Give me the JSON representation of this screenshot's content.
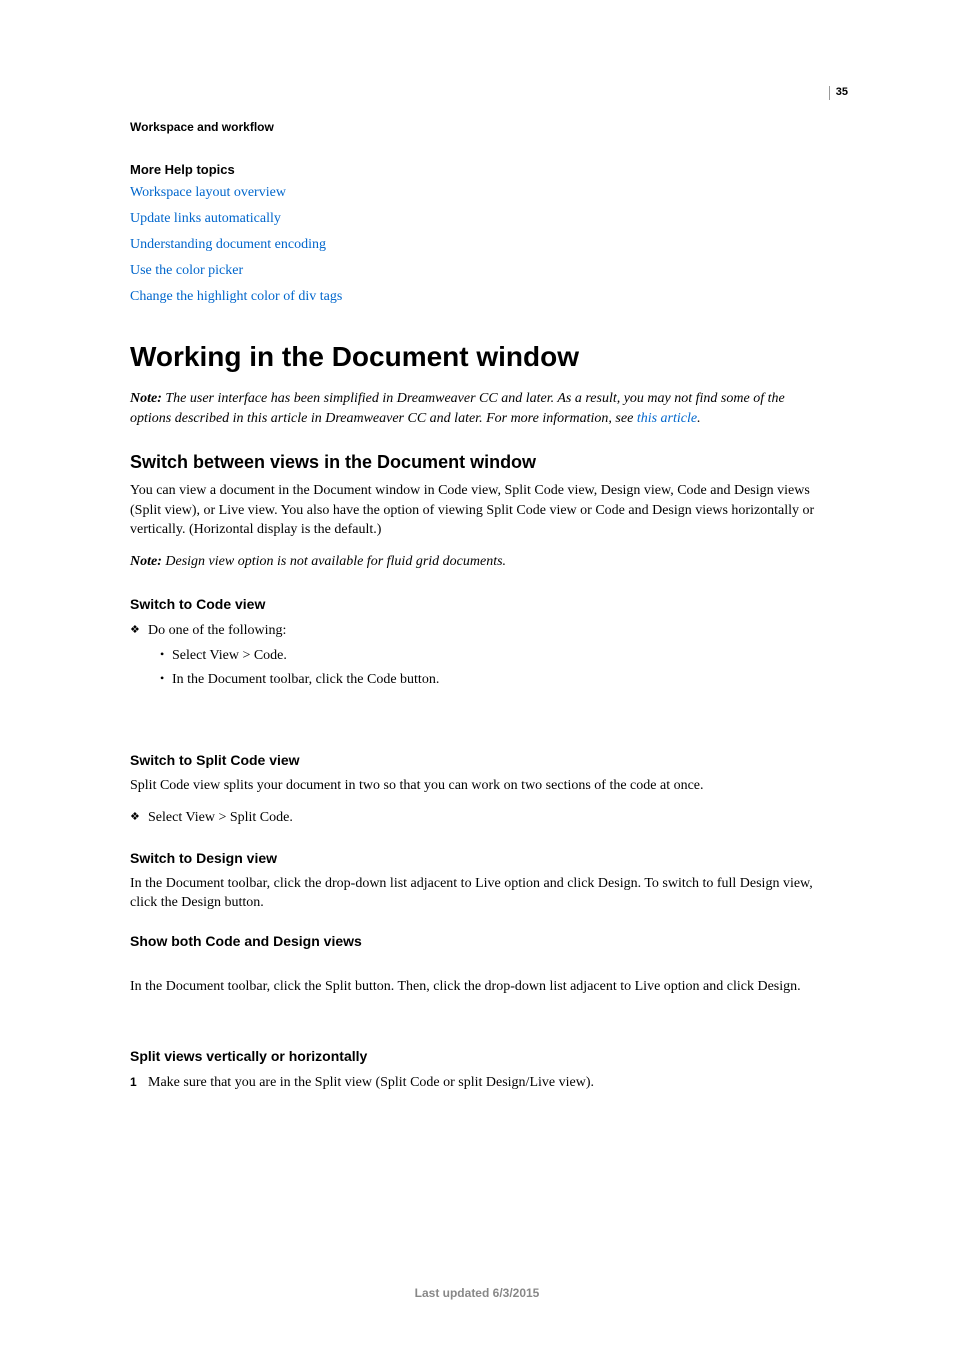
{
  "page_number": "35",
  "section_header": "Workspace and workflow",
  "help_topics": {
    "heading": "More Help topics",
    "links": [
      "Workspace layout overview",
      "Update links automatically",
      "Understanding document encoding",
      "Use the color picker",
      "Change the highlight color of div tags"
    ]
  },
  "main": {
    "title": "Working in the Document window",
    "note1": {
      "label": "Note:",
      "body_before": " The user interface has been simplified in Dreamweaver CC and later. As a result, you may not find some of the options described in this article in Dreamweaver CC and later. For more information, see ",
      "link": "this article",
      "body_after": "."
    },
    "section1": {
      "heading": "Switch between views in the Document window",
      "p1": "You can view a document in the Document window in Code view, Split Code view, Design view, Code and Design views (Split view), or Live view. You also have the option of viewing Split Code view or Code and Design views horizontally or vertically. (Horizontal display is the default.)",
      "note": {
        "label": "Note:",
        "body": " Design view option is not available for fluid grid documents."
      }
    },
    "sub1": {
      "heading": "Switch to Code view",
      "bullet": "Do one of the following:",
      "subitems": [
        "Select View > Code.",
        "In the Document toolbar, click the Code button."
      ]
    },
    "sub2": {
      "heading": "Switch to Split Code view",
      "p": "Split Code view splits your document in two so that you can work on two sections of the code at once.",
      "bullet": "Select View > Split Code."
    },
    "sub3": {
      "heading": "Switch to Design view",
      "p": "In the Document toolbar, click the drop-down list adjacent to Live option and click Design. To switch to full Design view, click the Design button."
    },
    "sub4": {
      "heading": "Show both Code and Design views",
      "p": "In the Document toolbar, click the Split button. Then, click the drop-down list adjacent to Live option and click Design."
    },
    "sub5": {
      "heading": "Split views vertically or horizontally",
      "num": "1",
      "item": "Make sure that you are in the Split view (Split Code or split Design/Live view)."
    }
  },
  "footer": "Last updated 6/3/2015"
}
